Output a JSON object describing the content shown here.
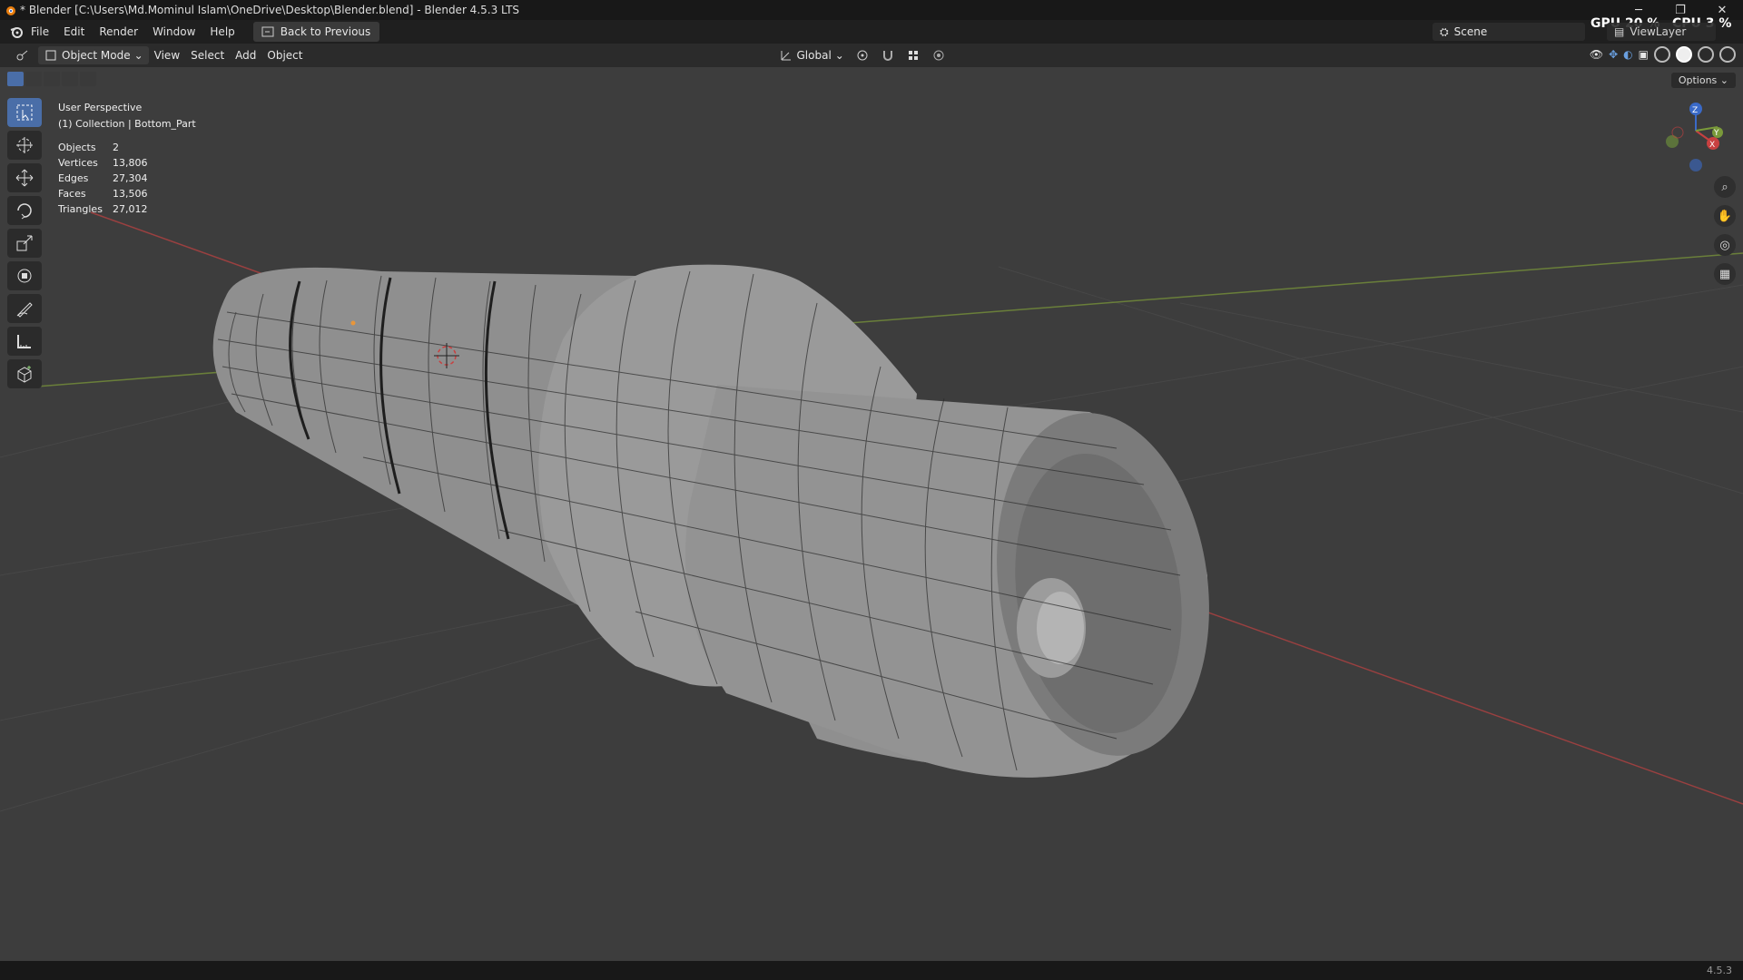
{
  "window": {
    "title": "* Blender [C:\\Users\\Md.Mominul Islam\\OneDrive\\Desktop\\Blender.blend] - Blender 4.5.3 LTS",
    "controls": [
      "─",
      "❐",
      "✕"
    ]
  },
  "menubar": {
    "items": [
      "File",
      "Edit",
      "Render",
      "Window",
      "Help"
    ],
    "back_button": "Back to Previous",
    "scene": "Scene",
    "view_layer": "ViewLayer",
    "gpu_label": "GPU",
    "gpu_value": "20 %",
    "cpu_label": "CPU",
    "cpu_value": "3 %"
  },
  "header3d": {
    "mode": "Object Mode",
    "menus": [
      "View",
      "Select",
      "Add",
      "Object"
    ],
    "transform_orientation": "Global",
    "options_label": "Options"
  },
  "viewport": {
    "perspective": "User Perspective",
    "collection": "(1) Collection | Bottom_Part",
    "stats": [
      {
        "label": "Objects",
        "value": "2"
      },
      {
        "label": "Vertices",
        "value": "13,806"
      },
      {
        "label": "Edges",
        "value": "27,304"
      },
      {
        "label": "Faces",
        "value": "13,506"
      },
      {
        "label": "Triangles",
        "value": "27,012"
      }
    ],
    "gizmo_axes": {
      "x": "X",
      "y": "Y",
      "z": "Z"
    }
  },
  "tools": [
    "select-box-icon",
    "cursor-icon",
    "move-icon",
    "rotate-icon",
    "scale-icon",
    "transform-icon",
    "annotate-icon",
    "measure-icon",
    "add-cube-icon"
  ],
  "status": {
    "version": "4.5.3"
  },
  "colors": {
    "accent": "#4a6ea8",
    "axis_x": "#b34a4a",
    "axis_y": "#6a8a3a",
    "axis_z": "#3a6ac8"
  }
}
